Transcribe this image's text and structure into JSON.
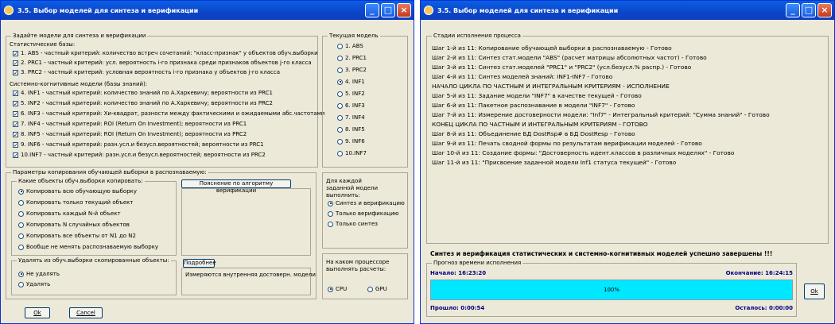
{
  "left_window": {
    "title": "3.5. Выбор моделей для синтеза и верификации",
    "models_group": {
      "title": "Задайте модели для синтеза и верификации",
      "stat_label": "Статистические базы:",
      "stat_items": [
        {
          "label": "1. ABS - частный критерий: количество встреч сочетаний: \"класс-признак\" у объектов обуч.выборки",
          "checked": true
        },
        {
          "label": "2. PRC1 - частный критерий: усл. вероятность i-го признака среди признаков объектов j-го класса",
          "checked": true
        },
        {
          "label": "3. PRC2 - частный критерий: условная вероятность i-го признака у объектов j-го класса",
          "checked": true
        }
      ],
      "know_label": "Системно-когнитивные модели (базы знаний):",
      "know_items": [
        {
          "label": "4. INF1 - частный критерий: количество знаний по А.Харкевичу; вероятности из PRC1",
          "checked": true
        },
        {
          "label": "5. INF2 - частный критерий: количество знаний по А.Харкевичу; вероятности из PRC2",
          "checked": true
        },
        {
          "label": "6. INF3 - частный критерий: Хи-квадрат, разности между фактическими и ожидаемыми абс.частотами",
          "checked": true
        },
        {
          "label": "7. INF4 - частный критерий: ROI (Return On Investment); вероятности из PRC1",
          "checked": true
        },
        {
          "label": "8. INF5 - частный критерий: ROI (Return On Investment); вероятности из PRC2",
          "checked": true
        },
        {
          "label": "9. INF6 - частный критерий: разн.усл.и безусл.вероятностей; вероятности из PRC1",
          "checked": true
        },
        {
          "label": "10.INF7 - частный критерий: разн.усл.и безусл.вероятностей; вероятности из PRC2",
          "checked": true
        }
      ]
    },
    "current_model": {
      "title": "Текущая модель",
      "options": [
        "1. ABS",
        "2. PRC1",
        "3. PRC2",
        "4. INF1",
        "5. INF2",
        "6. INF3",
        "7. INF4",
        "8. INF5",
        "9. INF6",
        "10.INF7"
      ],
      "selected": "4. INF1"
    },
    "params_group": {
      "title": "Параметры копирования обучающей выборки в распознаваемую:",
      "which_objects": {
        "title": "Какие объекты обуч.выборки копировать:",
        "options": [
          "Копировать всю обучающую выборку",
          "Копировать только текущий объект",
          "Копировать каждый N-й объект",
          "Копировать N случайных объектов",
          "Копировать все объекты от N1 до N2",
          "Вообще не менять распознаваемую выборку"
        ],
        "selected": "Копировать всю обучающую выборку"
      },
      "explain_button": "Пояснение по алгоритму верификации",
      "delete_group": {
        "title": "Удалять из обуч.выборки скопированные объекты:",
        "options": [
          "Не удалять",
          "Удалять"
        ],
        "selected": "Не удалять"
      },
      "details_button": "Подробнее",
      "details_text": "Измеряются внутренняя достоверн. модели"
    },
    "perform_group": {
      "title": "Для каждой заданной модели выполнить:",
      "options": [
        "Синтез и верификацию",
        "Только верификацию",
        "Только синтез"
      ],
      "selected": "Синтез и верификацию"
    },
    "cpu_group": {
      "title": "На каком процессоре выполнять расчеты:",
      "options": [
        "CPU",
        "GPU"
      ],
      "selected": "CPU"
    },
    "ok_button": "Ok",
    "cancel_button": "Cancel"
  },
  "right_window": {
    "title": "3.5. Выбор моделей для синтеза и верификации",
    "stages_title": "Стадии исполнения процесса",
    "stages": [
      "Шаг 1-й из 11: Копирование обучающей выборки в распознаваемую - Готово",
      "Шаг 2-й из 11: Синтез стат.модели \"ABS\" (расчет матрицы абсолютных частот) - Готово",
      "Шаг 3-й из 11: Синтез стат.моделей \"PRC1\" и \"PRC2\" (усл.безусл.% распр.) - Готово",
      "Шаг 4-й из 11: Синтез моделей знаний: INF1-INF7 - Готово",
      "НАЧАЛО ЦИКЛА ПО ЧАСТНЫМ И ИНТЕГРАЛЬНЫМ КРИТЕРИЯМ - ИСПОЛНЕНИЕ",
      "Шаг 5-й из 11: Задание модели \"INF7\" в качестве текущей - Готово",
      "Шаг 6-й из 11: Пакетное распознавание в модели \"INF7\" - Готово",
      "Шаг 7-й из 11: Измерение достоверности модели: \"Inf7\" - Интегральный критерий: \"Сумма знаний\" - Готово",
      "КОНЕЦ ЦИКЛА ПО ЧАСТНЫМ И ИНТЕГРАЛЬНЫМ КРИТЕРИЯМ - ГОТОВО",
      "Шаг 8-й из 11: Объединение БД DostRsp# в БД DostResp - Готово",
      "Шаг 9-й из 11: Печать сводной формы по результатам верификации моделей - Готово",
      "Шаг 10-й из 11: Создание формы: \"Достоверность идент.классов в различных моделях\" - Готово",
      "Шаг 11-й из 11: \"Присвоение заданной модели Inf1 статуса текущей\" - Готово"
    ],
    "done_message": "Синтез и верификация статистических и системно-когнитивных моделей успешно завершены !!!",
    "forecast_title": "Прогноз времени исполнения",
    "start_label": "Начало:",
    "start_time": "16:23:20",
    "end_label": "Окончание:",
    "end_time": "16:24:15",
    "progress_text": "100%",
    "progress": 1.0,
    "elapsed_label": "Прошло:",
    "elapsed_time": "0:00:54",
    "remaining_label": "Осталось:",
    "remaining_time": "0:00:00",
    "ok_button": "Ok"
  },
  "colors": {
    "titlebar": "#0c45c8",
    "window_bg": "#ece9d8",
    "progress": "#00e8ff",
    "label_navy": "#000080"
  }
}
